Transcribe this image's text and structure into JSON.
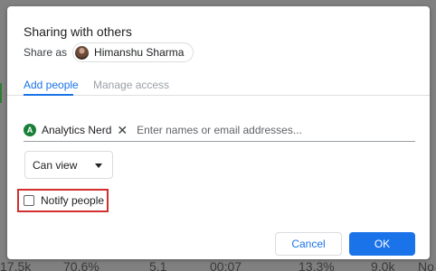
{
  "dialog": {
    "title": "Sharing with others",
    "share_as_label": "Share as",
    "share_as_user": "Himanshu Sharma",
    "tabs": [
      {
        "label": "Add people",
        "active": true
      },
      {
        "label": "Manage access",
        "active": false
      }
    ],
    "people": {
      "chips": [
        {
          "initial": "A",
          "name": "Analytics Nerd",
          "avatar_color": "#188038"
        }
      ],
      "input_placeholder": "Enter names or email addresses..."
    },
    "role_select": {
      "value": "Can view"
    },
    "notify": {
      "label": "Notify people",
      "checked": false,
      "highlight_color": "#d32f2f"
    },
    "buttons": {
      "cancel": "Cancel",
      "ok": "OK"
    }
  },
  "background": {
    "partial_values": [
      "17.5k",
      "70.6%",
      "5.1",
      "00:07",
      "13.3%",
      "9.0k",
      "No"
    ]
  },
  "colors": {
    "accent": "#1a73e8",
    "overlay": "#808080"
  }
}
